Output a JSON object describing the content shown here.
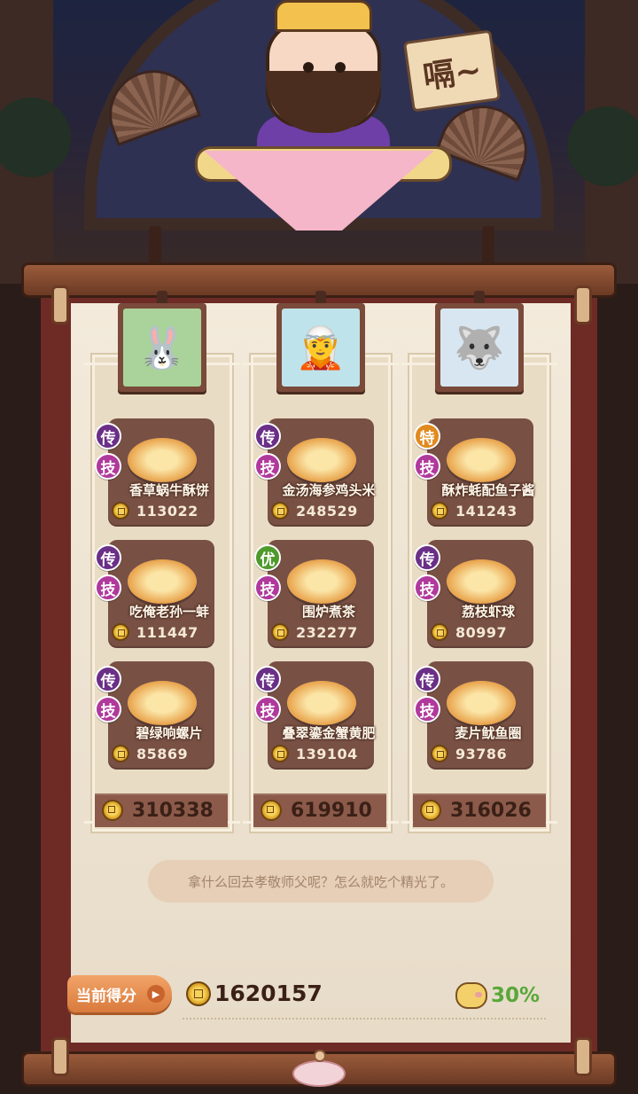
{
  "scene": {
    "master_sign": "嗝~"
  },
  "columns": [
    {
      "portrait_icon": "🐰",
      "portrait_bg": "#a9d39a",
      "dishes": [
        {
          "name": "香草蜗牛酥饼",
          "score": "113022",
          "badges": [
            "传",
            "技"
          ],
          "badge_types": [
            "legend",
            "skill"
          ]
        },
        {
          "name": "吃俺老孙一蚌",
          "score": "111447",
          "badges": [
            "传",
            "技"
          ],
          "badge_types": [
            "legend",
            "skill"
          ]
        },
        {
          "name": "碧绿响螺片",
          "score": "85869",
          "badges": [
            "传",
            "技"
          ],
          "badge_types": [
            "legend",
            "skill"
          ]
        }
      ],
      "total": "310338"
    },
    {
      "portrait_icon": "🧝",
      "portrait_bg": "#bfe3ea",
      "dishes": [
        {
          "name": "金汤海参鸡头米",
          "score": "248529",
          "badges": [
            "传",
            "技"
          ],
          "badge_types": [
            "legend",
            "skill"
          ]
        },
        {
          "name": "围炉煮茶",
          "score": "232277",
          "badges": [
            "优",
            "技"
          ],
          "badge_types": [
            "good",
            "skill"
          ]
        },
        {
          "name": "叠翠鎏金蟹黄肥",
          "score": "139104",
          "badges": [
            "传",
            "技"
          ],
          "badge_types": [
            "legend",
            "skill"
          ]
        }
      ],
      "total": "619910"
    },
    {
      "portrait_icon": "🐺",
      "portrait_bg": "#d7e6f0",
      "dishes": [
        {
          "name": "酥炸蚝配鱼子酱",
          "score": "141243",
          "badges": [
            "特",
            "技"
          ],
          "badge_types": [
            "special",
            "skill"
          ]
        },
        {
          "name": "荔枝虾球",
          "score": "80997",
          "badges": [
            "传",
            "技"
          ],
          "badge_types": [
            "legend",
            "skill"
          ]
        },
        {
          "name": "麦片鱿鱼圈",
          "score": "93786",
          "badges": [
            "传",
            "技"
          ],
          "badge_types": [
            "legend",
            "skill"
          ]
        }
      ],
      "total": "316026"
    }
  ],
  "quote": "拿什么回去孝敬师父呢？怎么就吃个精光了。",
  "current_score": {
    "label": "当前得分",
    "value": "1620157",
    "bonus": "30%"
  },
  "colors": {
    "legend_badge": "#6a2f86",
    "skill_badge": "#b0399c",
    "special_badge": "#e08a1e",
    "good_badge": "#4f9a2c",
    "bonus_green": "#58a83a",
    "label_orange": "#e8904e"
  }
}
